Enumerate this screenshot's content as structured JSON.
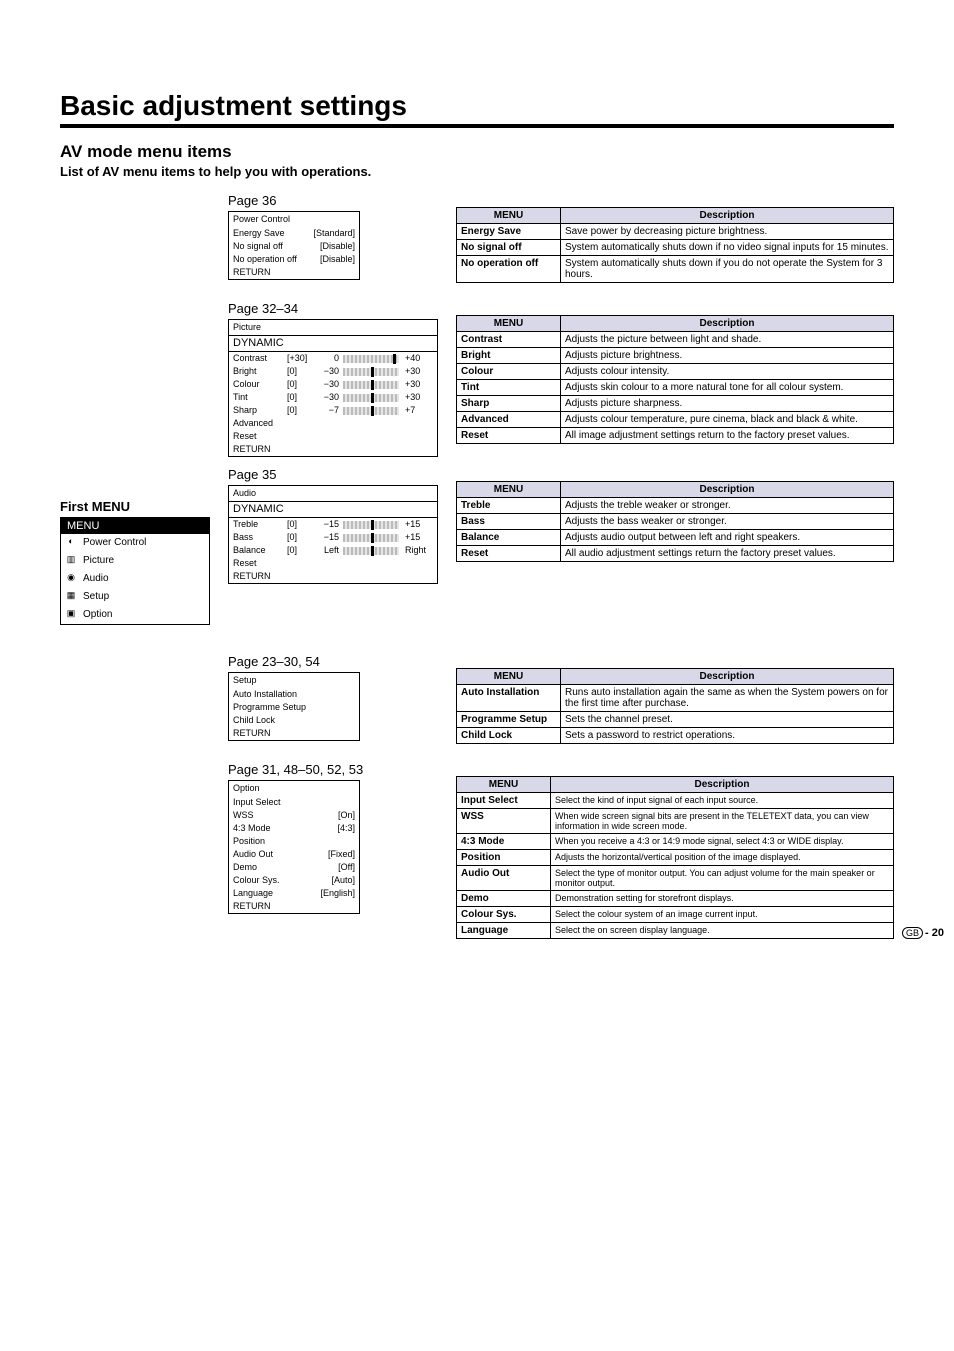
{
  "heading": "Basic adjustment settings",
  "subheading": "AV mode menu items",
  "intro": "List of AV menu items to help you with operations.",
  "first_menu_label": "First MENU",
  "first_menu": {
    "title": "MENU",
    "items": [
      "Power Control",
      "Picture",
      "Audio",
      "Setup",
      "Option"
    ]
  },
  "sections": {
    "power": {
      "page_ref": "Page 36",
      "osd_title": "Power Control",
      "rows": [
        {
          "label": "Energy Save",
          "value": "[Standard]"
        },
        {
          "label": "No signal off",
          "value": "[Disable]"
        },
        {
          "label": "No operation off",
          "value": "[Disable]"
        },
        {
          "label": "RETURN",
          "value": ""
        }
      ],
      "table": {
        "head": [
          "MENU",
          "Description"
        ],
        "rows": [
          [
            "Energy Save",
            "Save power by decreasing picture brightness."
          ],
          [
            "No signal off",
            "System automatically shuts down if no video signal inputs for 15 minutes."
          ],
          [
            "No operation off",
            "System automatically shuts down if you do not operate the System for 3 hours."
          ]
        ]
      }
    },
    "picture": {
      "page_ref": "Page 32–34",
      "osd_title": "Picture",
      "mode": "DYNAMIC",
      "sliders": [
        {
          "label": "Contrast",
          "val": "[+30]",
          "min": "0",
          "max": "+40",
          "pos": 90
        },
        {
          "label": "Bright",
          "val": "[0]",
          "min": "−30",
          "max": "+30",
          "pos": 50
        },
        {
          "label": "Colour",
          "val": "[0]",
          "min": "−30",
          "max": "+30",
          "pos": 50
        },
        {
          "label": "Tint",
          "val": "[0]",
          "min": "−30",
          "max": "+30",
          "pos": 50
        },
        {
          "label": "Sharp",
          "val": "[0]",
          "min": "−7",
          "max": "+7",
          "pos": 50
        }
      ],
      "extras": [
        "Advanced",
        "Reset",
        "RETURN"
      ],
      "table": {
        "head": [
          "MENU",
          "Description"
        ],
        "rows": [
          [
            "Contrast",
            "Adjusts the picture between light and shade."
          ],
          [
            "Bright",
            "Adjusts picture brightness."
          ],
          [
            "Colour",
            "Adjusts colour intensity."
          ],
          [
            "Tint",
            "Adjusts skin colour to a more natural tone for all colour system."
          ],
          [
            "Sharp",
            "Adjusts picture sharpness."
          ],
          [
            "Advanced",
            "Adjusts colour temperature, pure cinema, black and black & white."
          ],
          [
            "Reset",
            "All image adjustment settings return to the factory preset values."
          ]
        ]
      }
    },
    "audio": {
      "page_ref": "Page 35",
      "osd_title": "Audio",
      "mode": "DYNAMIC",
      "sliders": [
        {
          "label": "Treble",
          "val": "[0]",
          "min": "−15",
          "max": "+15",
          "pos": 50
        },
        {
          "label": "Bass",
          "val": "[0]",
          "min": "−15",
          "max": "+15",
          "pos": 50
        },
        {
          "label": "Balance",
          "val": "[0]",
          "min": "Left",
          "max": "Right",
          "pos": 50
        }
      ],
      "extras": [
        "Reset",
        "RETURN"
      ],
      "table": {
        "head": [
          "MENU",
          "Description"
        ],
        "rows": [
          [
            "Treble",
            "Adjusts the treble weaker or stronger."
          ],
          [
            "Bass",
            "Adjusts the bass weaker or stronger."
          ],
          [
            "Balance",
            "Adjusts audio output between left and right speakers."
          ],
          [
            "Reset",
            "All audio adjustment settings return the factory preset values."
          ]
        ]
      }
    },
    "setup": {
      "page_ref": "Page 23–30, 54",
      "osd_title": "Setup",
      "rows": [
        "Auto Installation",
        "Programme Setup",
        "Child Lock",
        "RETURN"
      ],
      "table": {
        "head": [
          "MENU",
          "Description"
        ],
        "rows": [
          [
            "Auto Installation",
            "Runs auto installation again the same as when the System powers on for the first time after purchase."
          ],
          [
            "Programme Setup",
            "Sets the channel preset."
          ],
          [
            "Child Lock",
            "Sets a password to restrict operations."
          ]
        ]
      }
    },
    "option": {
      "page_ref": "Page 31, 48–50, 52, 53",
      "osd_title": "Option",
      "rows": [
        {
          "label": "Input Select",
          "value": ""
        },
        {
          "label": "WSS",
          "value": "[On]"
        },
        {
          "label": "4:3 Mode",
          "value": "[4:3]"
        },
        {
          "label": "Position",
          "value": ""
        },
        {
          "label": "Audio Out",
          "value": "[Fixed]"
        },
        {
          "label": "Demo",
          "value": "[Off]"
        },
        {
          "label": "Colour Sys.",
          "value": "[Auto]"
        },
        {
          "label": "Language",
          "value": "[English]"
        },
        {
          "label": "RETURN",
          "value": ""
        }
      ],
      "table": {
        "head": [
          "MENU",
          "Description"
        ],
        "rows": [
          [
            "Input Select",
            "Select the kind of input signal of each input source."
          ],
          [
            "WSS",
            "When wide screen signal bits are present in the TELETEXT data, you can view information in wide screen mode."
          ],
          [
            "4:3 Mode",
            "When you receive a 4:3 or 14:9 mode signal, select 4:3 or WIDE display."
          ],
          [
            "Position",
            "Adjusts the horizontal/vertical position of the image displayed."
          ],
          [
            "Audio Out",
            "Select the type of monitor output. You can adjust volume for the main speaker or monitor output."
          ],
          [
            "Demo",
            "Demonstration setting for storefront displays."
          ],
          [
            "Colour Sys.",
            "Select the colour system of an image current input."
          ],
          [
            "Language",
            "Select the on screen display language."
          ]
        ]
      }
    }
  },
  "page_number": {
    "region": "GB",
    "num": "- 20"
  }
}
